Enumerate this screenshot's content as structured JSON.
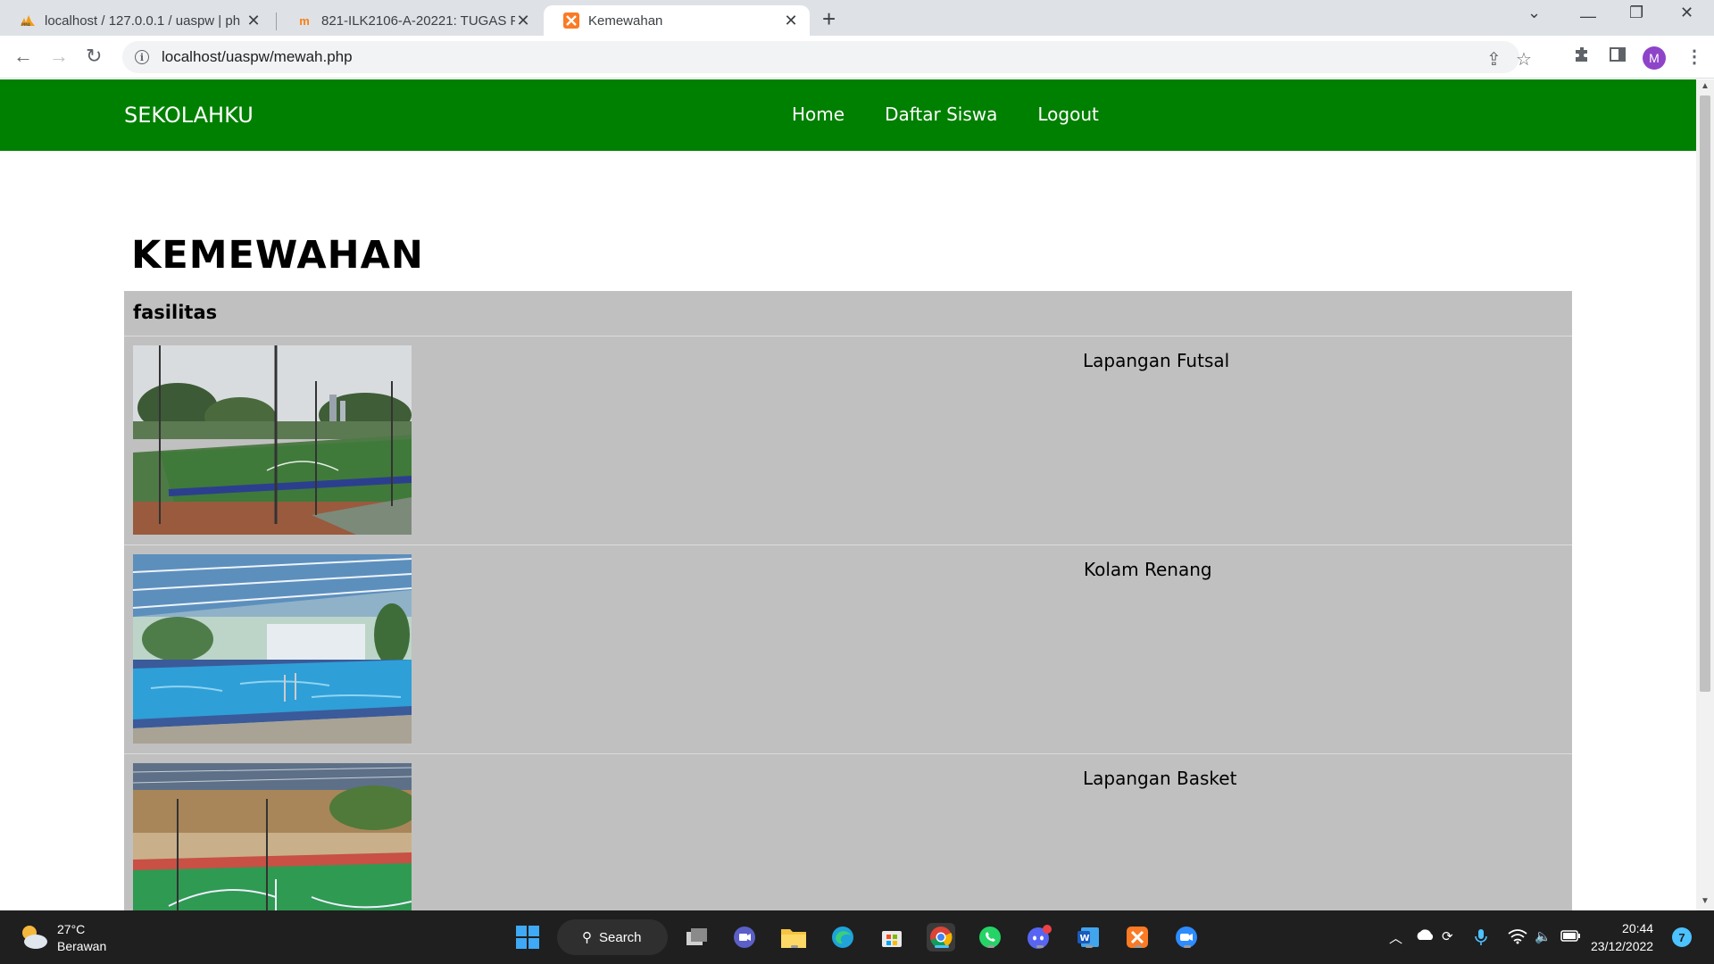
{
  "browser": {
    "tabs": [
      {
        "title": "localhost / 127.0.0.1 / uaspw | ph",
        "icon": "phpmyadmin-icon"
      },
      {
        "title": "821-ILK2106-A-20221: TUGAS PE",
        "icon": "moodle-icon"
      },
      {
        "title": "Kemewahan",
        "icon": "xampp-icon"
      }
    ],
    "url": "localhost/uaspw/mewah.php",
    "profile_initial": "M"
  },
  "site": {
    "brand": "SEKOLAHKU",
    "nav": [
      "Home",
      "Daftar Siswa",
      "Logout"
    ],
    "nav_color": "#008000"
  },
  "page": {
    "title": "KEMEWAHAN",
    "table_header": "fasilitas",
    "table_bg": "#c0c0c0",
    "facilities": [
      {
        "name": "Lapangan Futsal",
        "image": "futsal-court-photo"
      },
      {
        "name": "Kolam Renang",
        "image": "swimming-pool-photo"
      },
      {
        "name": "Lapangan Basket",
        "image": "basketball-court-photo"
      }
    ]
  },
  "taskbar": {
    "weather_temp": "27°C",
    "weather_desc": "Berawan",
    "search_label": "Search",
    "time": "20:44",
    "date": "23/12/2022",
    "notification_count": "7"
  }
}
